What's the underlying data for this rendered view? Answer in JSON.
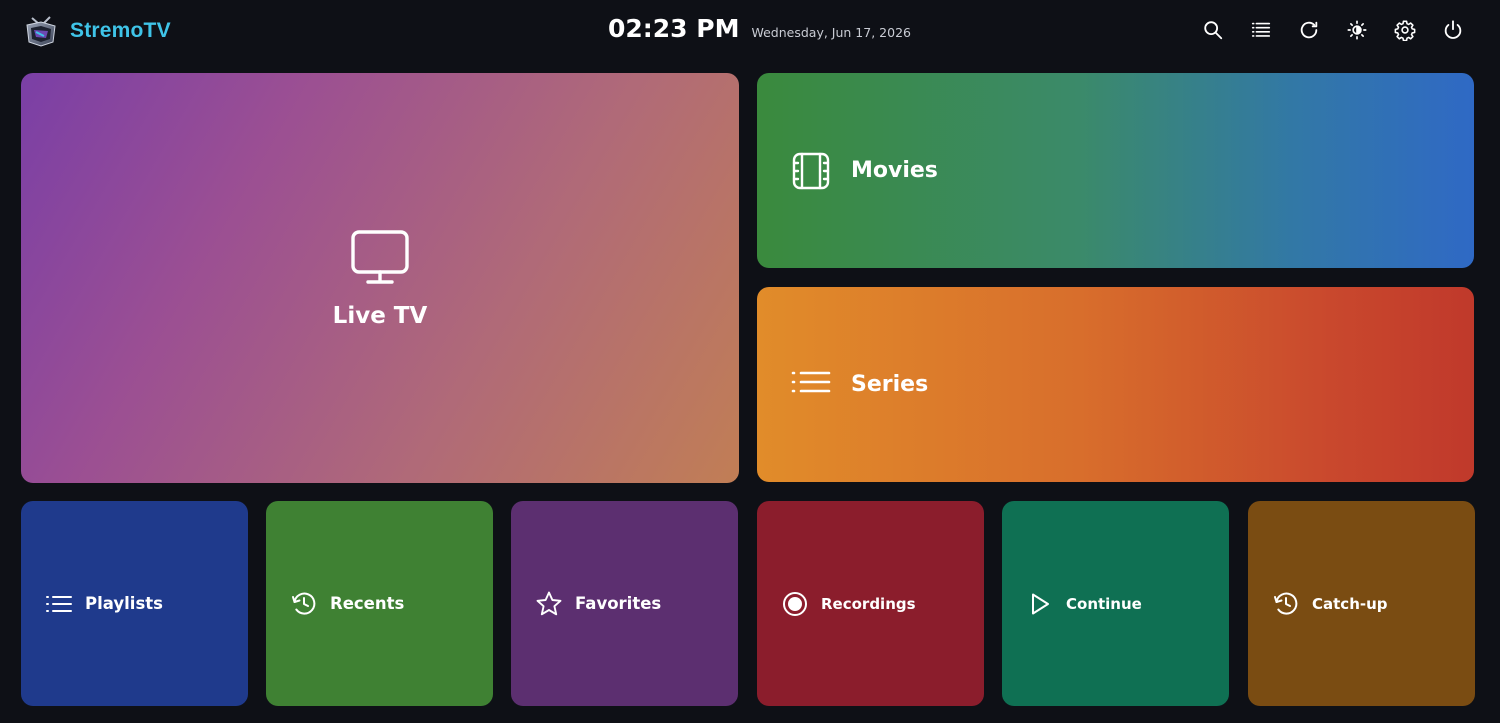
{
  "app": {
    "name": "StremoTV"
  },
  "clock": {
    "time": "02:23 PM",
    "date": "Wednesday, Jun 17, 2026"
  },
  "toolbar": {
    "icons": [
      "search-icon",
      "list-icon",
      "refresh-icon",
      "brightness-icon",
      "gear-icon",
      "power-icon"
    ]
  },
  "tiles": {
    "live_tv": {
      "label": "Live TV",
      "icon": "tv-icon"
    },
    "movies": {
      "label": "Movies",
      "icon": "film-icon"
    },
    "series": {
      "label": "Series",
      "icon": "list-icon"
    },
    "playlists": {
      "label": "Playlists",
      "icon": "list-icon"
    },
    "recents": {
      "label": "Recents",
      "icon": "history-icon"
    },
    "favorites": {
      "label": "Favorites",
      "icon": "star-icon"
    },
    "recordings": {
      "label": "Recordings",
      "icon": "record-icon"
    },
    "continue": {
      "label": "Continue",
      "icon": "play-icon"
    },
    "catchup": {
      "label": "Catch-up",
      "icon": "history-icon"
    }
  },
  "colors": {
    "brand": "#3fc4e8",
    "background": "#0e1016",
    "playlists": "#1f3a8c",
    "recents": "#3f8133",
    "favorites": "#5c2f70",
    "recordings": "#8b1d2c",
    "continue": "#0f7053",
    "catchup": "#7a4c12"
  }
}
